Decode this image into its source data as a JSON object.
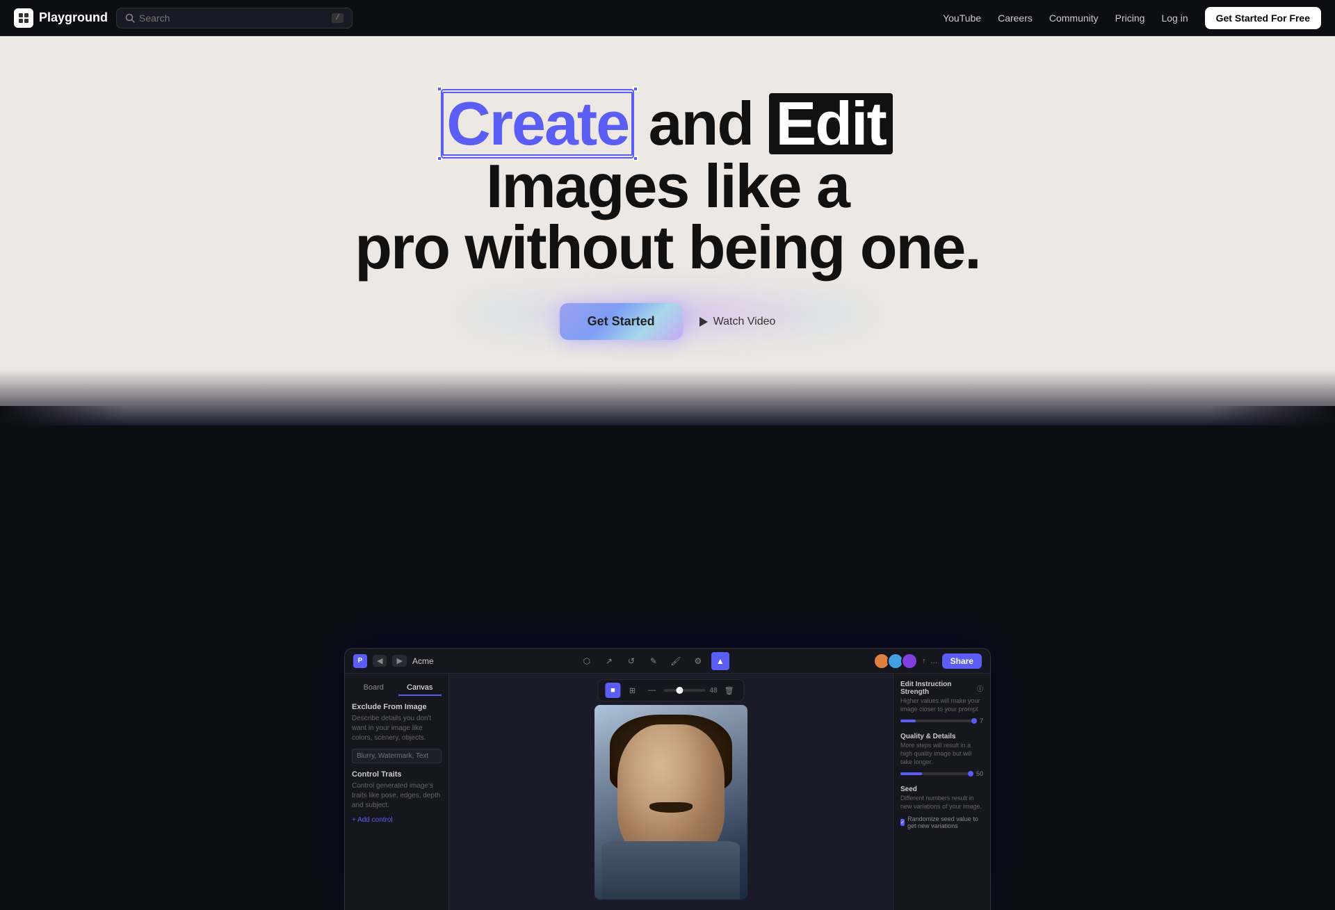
{
  "nav": {
    "logo_text": "Playground",
    "search_placeholder": "Search",
    "search_shortcut": "/",
    "links": [
      {
        "label": "YouTube",
        "name": "youtube"
      },
      {
        "label": "Careers",
        "name": "careers"
      },
      {
        "label": "Community",
        "name": "community"
      },
      {
        "label": "Pricing",
        "name": "pricing"
      }
    ],
    "login_label": "Log in",
    "cta_label": "Get Started For Free"
  },
  "hero": {
    "headline_word1": "Create",
    "headline_mid": " and ",
    "headline_word2": "Edit",
    "headline_end": " Images like a pro without being one.",
    "cta_label": "Get Started",
    "watch_label": "Watch Video"
  },
  "mockup": {
    "project_name": "Acme",
    "share_label": "Share",
    "tab_board": "Board",
    "tab_canvas": "Canvas",
    "left_panel": {
      "section1_title": "Exclude From Image",
      "section1_desc": "Describe details you don't want in your image like colors, scenery, objects.",
      "section1_placeholder": "Blurry, Watermark, Text",
      "section2_title": "Control Traits",
      "section2_desc": "Control generated image's traits like pose, edges, depth and subject.",
      "add_control_label": "+ Add control"
    },
    "right_panel": {
      "section1_title": "Edit Instruction Strength",
      "section1_desc": "Higher values will make your image closer to your prompt",
      "section1_value": "7",
      "section1_fill": "20",
      "section2_title": "Quality & Details",
      "section2_desc": "More steps will result in a high quality image but will take longer.",
      "section2_value": "50",
      "section2_fill": "30",
      "section3_title": "Seed",
      "section3_desc": "Different numbers result in new variations of your image.",
      "checkbox_label": "Randomize seed value to get new variations"
    },
    "canvas_value": "48"
  }
}
